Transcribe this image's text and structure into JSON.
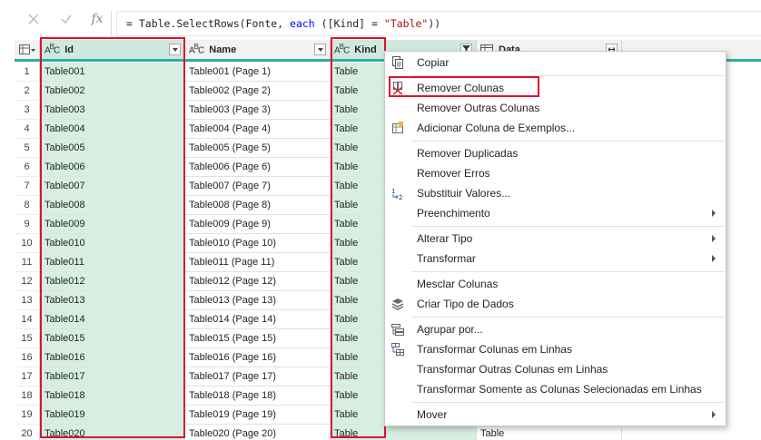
{
  "formula": {
    "prefix": "= Table.SelectRows(Fonte, ",
    "keyword": "each",
    "middle": " ([Kind] = ",
    "string": "\"Table\"",
    "suffix": "))",
    "fx": "fx"
  },
  "columns": {
    "id": {
      "label": "Id",
      "type_icon": "ABC"
    },
    "name": {
      "label": "Name",
      "type_icon": "ABC"
    },
    "kind": {
      "label": "Kind",
      "type_icon": "ABC"
    },
    "data": {
      "label": "Data"
    }
  },
  "rows": [
    {
      "n": "1",
      "id": "Table001",
      "name": "Table001 (Page 1)",
      "kind": "Table"
    },
    {
      "n": "2",
      "id": "Table002",
      "name": "Table002 (Page 2)",
      "kind": "Table"
    },
    {
      "n": "3",
      "id": "Table003",
      "name": "Table003 (Page 3)",
      "kind": "Table"
    },
    {
      "n": "4",
      "id": "Table004",
      "name": "Table004 (Page 4)",
      "kind": "Table"
    },
    {
      "n": "5",
      "id": "Table005",
      "name": "Table005 (Page 5)",
      "kind": "Table"
    },
    {
      "n": "6",
      "id": "Table006",
      "name": "Table006 (Page 6)",
      "kind": "Table"
    },
    {
      "n": "7",
      "id": "Table007",
      "name": "Table007 (Page 7)",
      "kind": "Table"
    },
    {
      "n": "8",
      "id": "Table008",
      "name": "Table008 (Page 8)",
      "kind": "Table"
    },
    {
      "n": "9",
      "id": "Table009",
      "name": "Table009 (Page 9)",
      "kind": "Table"
    },
    {
      "n": "10",
      "id": "Table010",
      "name": "Table010 (Page 10)",
      "kind": "Table"
    },
    {
      "n": "11",
      "id": "Table011",
      "name": "Table011 (Page 11)",
      "kind": "Table"
    },
    {
      "n": "12",
      "id": "Table012",
      "name": "Table012 (Page 12)",
      "kind": "Table"
    },
    {
      "n": "13",
      "id": "Table013",
      "name": "Table013 (Page 13)",
      "kind": "Table"
    },
    {
      "n": "14",
      "id": "Table014",
      "name": "Table014 (Page 14)",
      "kind": "Table"
    },
    {
      "n": "15",
      "id": "Table015",
      "name": "Table015 (Page 15)",
      "kind": "Table"
    },
    {
      "n": "16",
      "id": "Table016",
      "name": "Table016 (Page 16)",
      "kind": "Table"
    },
    {
      "n": "17",
      "id": "Table017",
      "name": "Table017 (Page 17)",
      "kind": "Table"
    },
    {
      "n": "18",
      "id": "Table018",
      "name": "Table018 (Page 18)",
      "kind": "Table"
    },
    {
      "n": "19",
      "id": "Table019",
      "name": "Table019 (Page 19)",
      "kind": "Table"
    },
    {
      "n": "20",
      "id": "Table020",
      "name": "Table020 (Page 20)",
      "kind": "Table",
      "data": "Table"
    }
  ],
  "menu": {
    "items": [
      {
        "label": "Copiar",
        "icon": "copy-icon"
      },
      {
        "label": "Remover Colunas",
        "icon": "remove-columns-icon"
      },
      {
        "label": "Remover Outras Colunas"
      },
      {
        "label": "Adicionar Coluna de Exemplos...",
        "icon": "column-examples-icon"
      },
      {
        "label": "Remover Duplicadas"
      },
      {
        "label": "Remover Erros"
      },
      {
        "label": "Substituir Valores...",
        "icon": "replace-values-icon"
      },
      {
        "label": "Preenchimento",
        "submenu": true
      },
      {
        "label": "Alterar Tipo",
        "submenu": true
      },
      {
        "label": "Transformar",
        "submenu": true
      },
      {
        "label": "Mesclar Colunas"
      },
      {
        "label": "Criar Tipo de Dados",
        "icon": "data-type-icon"
      },
      {
        "label": "Agrupar por...",
        "icon": "group-by-icon"
      },
      {
        "label": "Transformar Colunas em Linhas",
        "icon": "unpivot-icon"
      },
      {
        "label": "Transformar Outras Colunas em Linhas"
      },
      {
        "label": "Transformar Somente as Colunas Selecionadas em Linhas"
      },
      {
        "label": "Mover",
        "submenu": true
      }
    ]
  },
  "colors": {
    "highlight": "#e0112b",
    "selected_column": "#d7efe2",
    "accent": "#2ab0a5"
  }
}
